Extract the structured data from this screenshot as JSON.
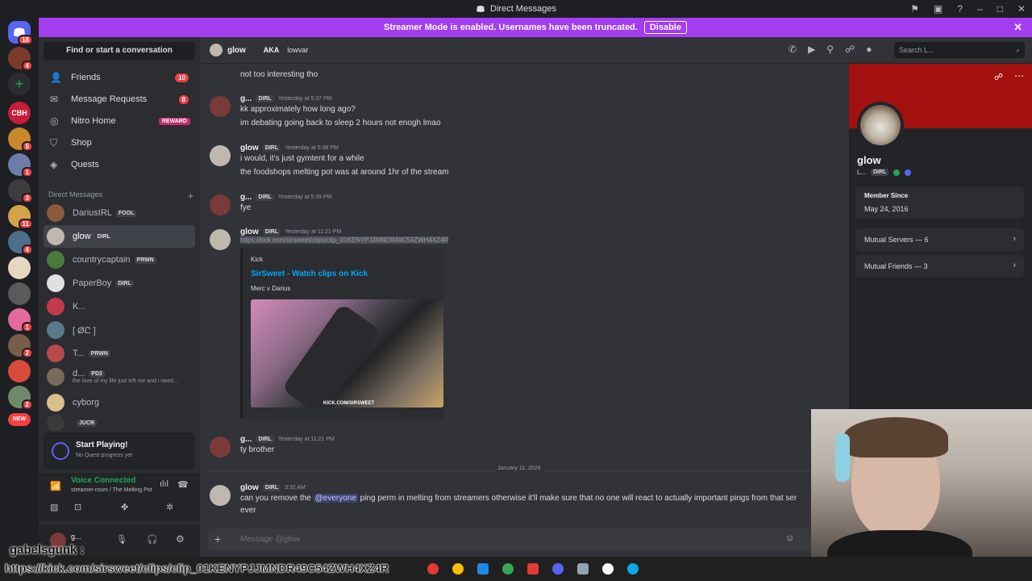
{
  "titlebar": {
    "title": "Direct Messages"
  },
  "banner": {
    "text": "Streamer Mode is enabled. Usernames have been truncated.",
    "button": "Disable"
  },
  "rail": {
    "badges": [
      "18",
      "4",
      "1",
      "5",
      "1",
      "3",
      "11",
      "4",
      "1",
      "2",
      "2",
      "NEW"
    ],
    "cbh": "CBH"
  },
  "sidebar": {
    "search_label": "Find or start a conversation",
    "nav": [
      {
        "label": "Friends",
        "count": "10"
      },
      {
        "label": "Message Requests",
        "count": "8"
      },
      {
        "label": "Nitro Home",
        "badge": "REWARD"
      },
      {
        "label": "Shop"
      },
      {
        "label": "Quests"
      }
    ],
    "dm_header": "Direct Messages",
    "dms": [
      {
        "name": "DariusIRL",
        "tag": "FOOL"
      },
      {
        "name": "glow",
        "tag": "DIRL"
      },
      {
        "name": "countrycaptain",
        "tag": "PRWN"
      },
      {
        "name": "PaperBoy",
        "tag": "DIRL"
      },
      {
        "name": "K..."
      },
      {
        "name": "[ ØԸ ]"
      },
      {
        "name": "T...",
        "tag": "PRWN"
      },
      {
        "name": "d...",
        "tag": "PD2",
        "sub": "the love of my life just left me and i need..."
      },
      {
        "name": "cyborg"
      },
      {
        "name": "",
        "tag": "JUCR"
      }
    ],
    "quest": {
      "title": "Start Playing!",
      "sub": "No Quest progress yet"
    },
    "voice": {
      "status": "Voice Connected",
      "channel": "streamer-room / The Melting Pot"
    },
    "user": {
      "name": "g...",
      "overlay_name": "gabelsgunk :"
    }
  },
  "chat_header": {
    "name": "glow",
    "aka": "AKA",
    "alias": "lowvar",
    "search_placeholder": "Search L..."
  },
  "messages": {
    "top_line": "not too interesting tho",
    "m1": {
      "name": "g...",
      "tag": "DIRL",
      "time": "Yesterday at 5:37 PM",
      "lines": [
        "kk approximately how long ago?",
        "im debating going back to sleep 2 hours not enogh lmao"
      ]
    },
    "m2": {
      "name": "glow",
      "tag": "DIRL",
      "time": "Yesterday at 5:38 PM",
      "lines": [
        "i would, it's just gymtent for a while",
        "the foodshops melting pot was at around 1hr of the stream"
      ]
    },
    "m3": {
      "name": "g...",
      "tag": "DIRL",
      "time": "Yesterday at 5:39 PM",
      "lines": [
        "fye"
      ]
    },
    "m4": {
      "name": "glow",
      "tag": "DIRL",
      "time": "Yesterday at 11:21 PM",
      "link": "https://kick.com/sirsweet/clips/clip_01KENYPJJMNDR49C54ZWH4XZ4R"
    },
    "embed": {
      "provider": "Kick",
      "title": "SirSweet - Watch clips on Kick",
      "description": "Merc v Darius",
      "watermark": "KICK.COM/SIRSWEET"
    },
    "m5": {
      "name": "g...",
      "tag": "DIRL",
      "time": "Yesterday at 11:21 PM",
      "lines": [
        "ty brother"
      ]
    },
    "date_separator": "January 11, 2026",
    "m6": {
      "name": "glow",
      "tag": "DIRL",
      "time": "3:32 AM",
      "pre": "can you remove the ",
      "mention": "@everyone",
      "post": " ping perm in melting from streamers otherwise it'll make sure that no one will react to actually important pings from that ser",
      "line2": "ever"
    },
    "composer_placeholder": "Message @glow"
  },
  "profile": {
    "name": "glow",
    "discriminator": "L...",
    "tag": "DIRL",
    "member_since_label": "Member Since",
    "member_since": "May 24, 2016",
    "mutual_servers": "Mutual Servers — 6",
    "mutual_friends": "Mutual Friends — 3"
  },
  "overlay": {
    "url": "https://kick.com/sirsweet/clips/clip_01KENYPJJMNDR49C54ZWH4XZ4R"
  },
  "colors": {
    "banner": "#a23df0",
    "profile_banner": "#a31010",
    "link": "#00a8fc",
    "badge": "#f23f42"
  }
}
